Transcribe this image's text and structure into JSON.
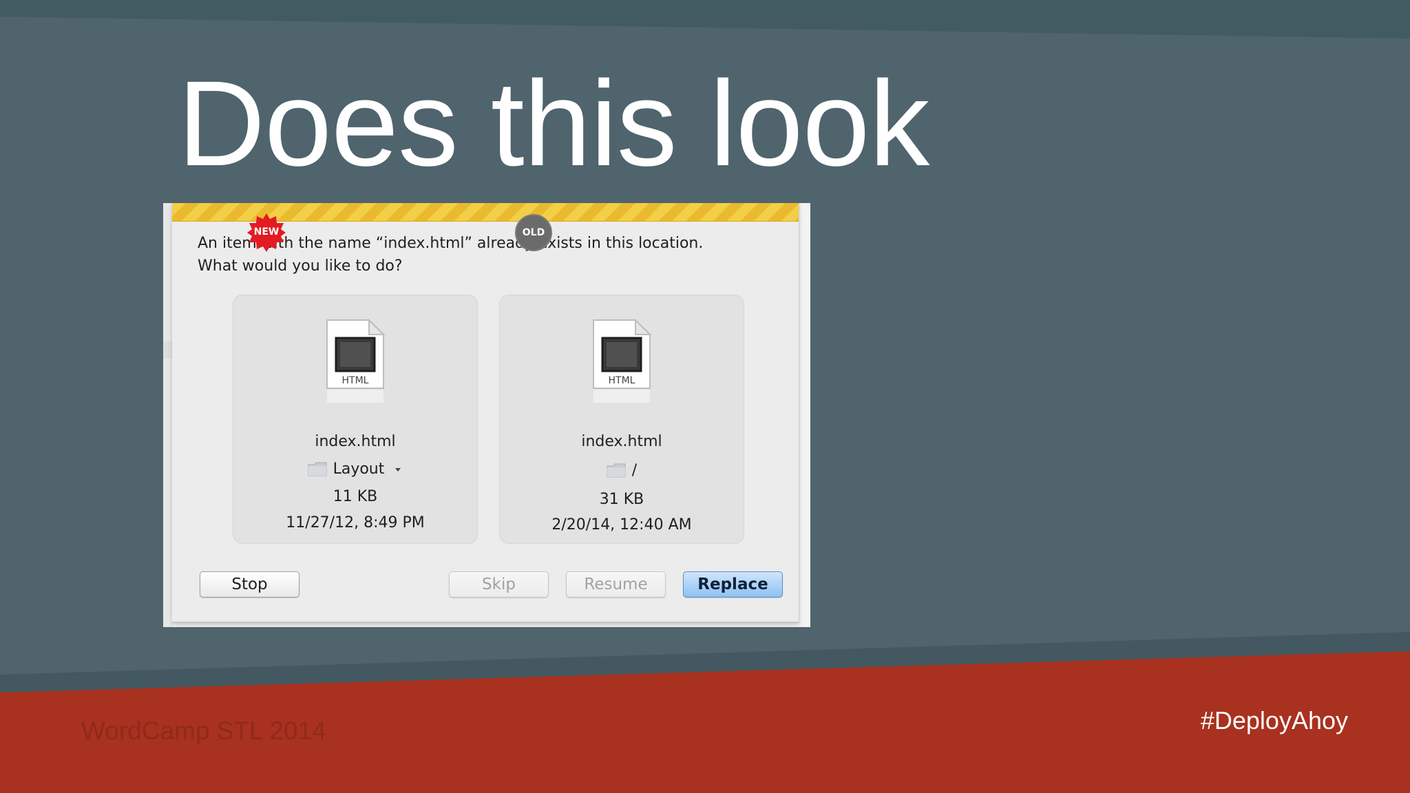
{
  "slide": {
    "title": "Does this look",
    "footer_left": "WordCamp STL 2014",
    "footer_right": "#DeployAhoy",
    "colors": {
      "background": "#4f646c",
      "top_band": "#425a61",
      "footer_band": "#a9311f",
      "title_text": "#ffffff"
    }
  },
  "dialog": {
    "message_line1": "An item with the name “index.html” already exists in this location.",
    "message_line2": "What would you like to do?",
    "new_item": {
      "badge": "NEW",
      "icon_label": "HTML",
      "filename": "index.html",
      "folder": "Layout",
      "size": "11 KB",
      "modified": "11/27/12, 8:49 PM"
    },
    "old_item": {
      "badge": "OLD",
      "icon_label": "HTML",
      "filename": "index.html",
      "folder": "/",
      "size": "31 KB",
      "modified": "2/20/14, 12:40 AM"
    },
    "buttons": {
      "stop": "Stop",
      "skip": "Skip",
      "resume": "Resume",
      "replace": "Replace"
    },
    "icons": {
      "file": "html-file-icon",
      "folder": "folder-icon",
      "dropdown": "chevron-down-icon",
      "new_badge": "new-badge-icon",
      "old_badge": "old-badge-icon"
    }
  }
}
